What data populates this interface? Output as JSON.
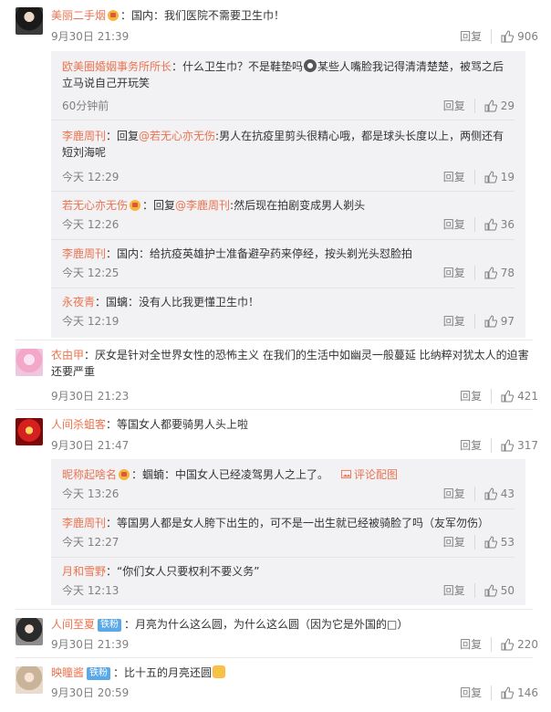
{
  "comments": [
    {
      "user": "美丽二手烟",
      "text": "：国内：我们医院不需要卫生巾！",
      "time": "9月30日 21:39",
      "reply": "回复",
      "likes": "906",
      "subs": [
        {
          "user": "欧美圈婚姻事务所所长",
          "text_a": "：什么卫生巾？不是鞋垫吗",
          "text_b": "某些人嘴脸我记得清清楚楚，被骂之后立马说自己开玩笑",
          "time": "60分钟前",
          "reply": "回复",
          "likes": "29"
        },
        {
          "user": "李鹿周刊",
          "text_a": "：回复",
          "mention": "@若无心亦无伤",
          "text_b": ":男人在抗疫里剪头很精心哦，都是球头长度以上，两侧还有短刘海呢",
          "time": "今天 12:29",
          "reply": "回复",
          "likes": "19"
        },
        {
          "user": "若无心亦无伤",
          "text_a": "：回复",
          "mention": "@李鹿周刊",
          "text_b": ":然后现在拍剧变成男人剃头",
          "time": "今天 12:26",
          "reply": "回复",
          "likes": "36"
        },
        {
          "user": "李鹿周刊",
          "text_a": "：国内：给抗疫英雄护士准备避孕药来停经，按头剃光头怼脸拍",
          "time": "今天 12:25",
          "reply": "回复",
          "likes": "78"
        },
        {
          "user": "永夜青",
          "text_a": "：国螭：没有人比我更懂卫生巾！",
          "time": "今天 12:19",
          "reply": "回复",
          "likes": "97"
        }
      ]
    },
    {
      "user": "衣由甲",
      "text": "：厌女是针对全世界女性的恐怖主义 在我们的生活中如幽灵一般蔓延 比纳粹对犹太人的迫害还要严重",
      "time": "9月30日 21:23",
      "reply": "回复",
      "likes": "421"
    },
    {
      "user": "人间杀蛆客",
      "text": "：等国女人都要骑男人头上啦",
      "time": "9月30日 21:47",
      "reply": "回复",
      "likes": "317",
      "subs": [
        {
          "user": "昵称起啥名",
          "text_a": "：蝈蝻：中国女人已经凌驾男人之上了。",
          "img_link": "评论配图",
          "time": "今天 13:26",
          "reply": "回复",
          "likes": "43"
        },
        {
          "user": "李鹿周刊",
          "text_a": "：等国男人都是女人胯下出生的，可不是一出生就已经被骑脸了吗（友军勿伤）",
          "time": "今天 12:27",
          "reply": "回复",
          "likes": "53"
        },
        {
          "user": "月和雪野",
          "text_a": "：“你们女人只要权利不要义务”",
          "time": "今天 12:13",
          "reply": "回复",
          "likes": "50"
        }
      ]
    },
    {
      "user": "人间至夏",
      "badge": "铁粉",
      "text": "：月亮为什么这么圆，为什么这么圆（因为它是外国的□）",
      "time": "9月30日 21:39",
      "reply": "回复",
      "likes": "220"
    },
    {
      "user": "映瞳酱",
      "badge": "铁粉",
      "text": "：比十五的月亮还圆",
      "time": "9月30日 20:59",
      "reply": "回复",
      "likes": "146"
    }
  ]
}
